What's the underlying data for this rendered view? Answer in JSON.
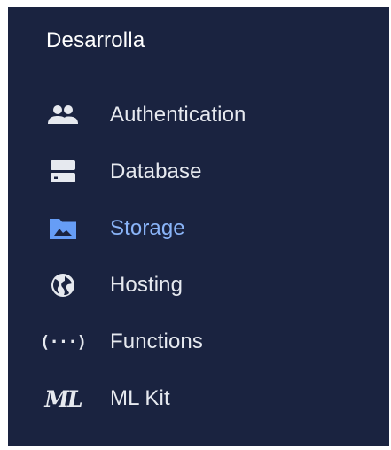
{
  "sidebar": {
    "section_title": "Desarrolla",
    "items": [
      {
        "label": "Authentication",
        "icon": "people-icon",
        "active": false
      },
      {
        "label": "Database",
        "icon": "database-icon",
        "active": false
      },
      {
        "label": "Storage",
        "icon": "folder-image-icon",
        "active": true
      },
      {
        "label": "Hosting",
        "icon": "globe-icon",
        "active": false
      },
      {
        "label": "Functions",
        "icon": "functions-icon",
        "active": false
      },
      {
        "label": "ML Kit",
        "icon": "ml-kit-icon",
        "active": false
      }
    ]
  },
  "colors": {
    "panel_background": "#1a2340",
    "text": "#e6e9ef",
    "active_text": "#8ab4f8",
    "active_icon": "#669df6"
  }
}
